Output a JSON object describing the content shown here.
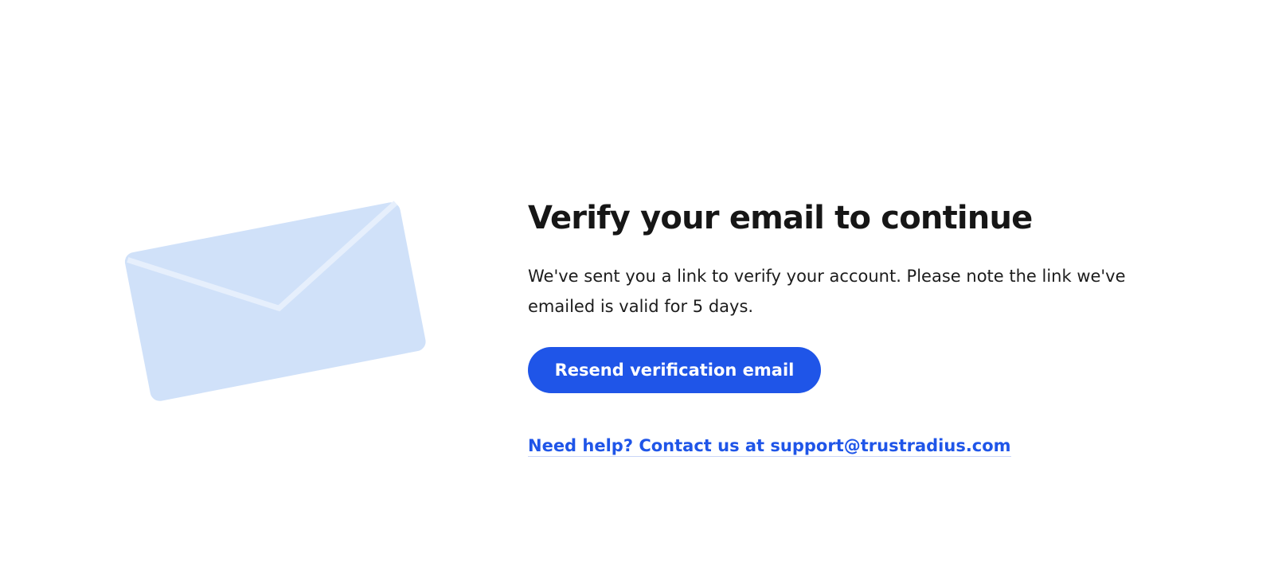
{
  "illustration": {
    "icon": "envelope-icon",
    "color": "#d0e1f9"
  },
  "main": {
    "title": "Verify your email to continue",
    "description": "We've sent you a link to verify your account. Please note the link we've emailed is valid for 5 days.",
    "resend_button_label": "Resend verification email",
    "help_link_text": "Need help? Contact us at support@trustradius.com"
  },
  "colors": {
    "accent": "#1f55e8",
    "envelope": "#d0e1f9",
    "envelope_fold": "#e6effc"
  }
}
